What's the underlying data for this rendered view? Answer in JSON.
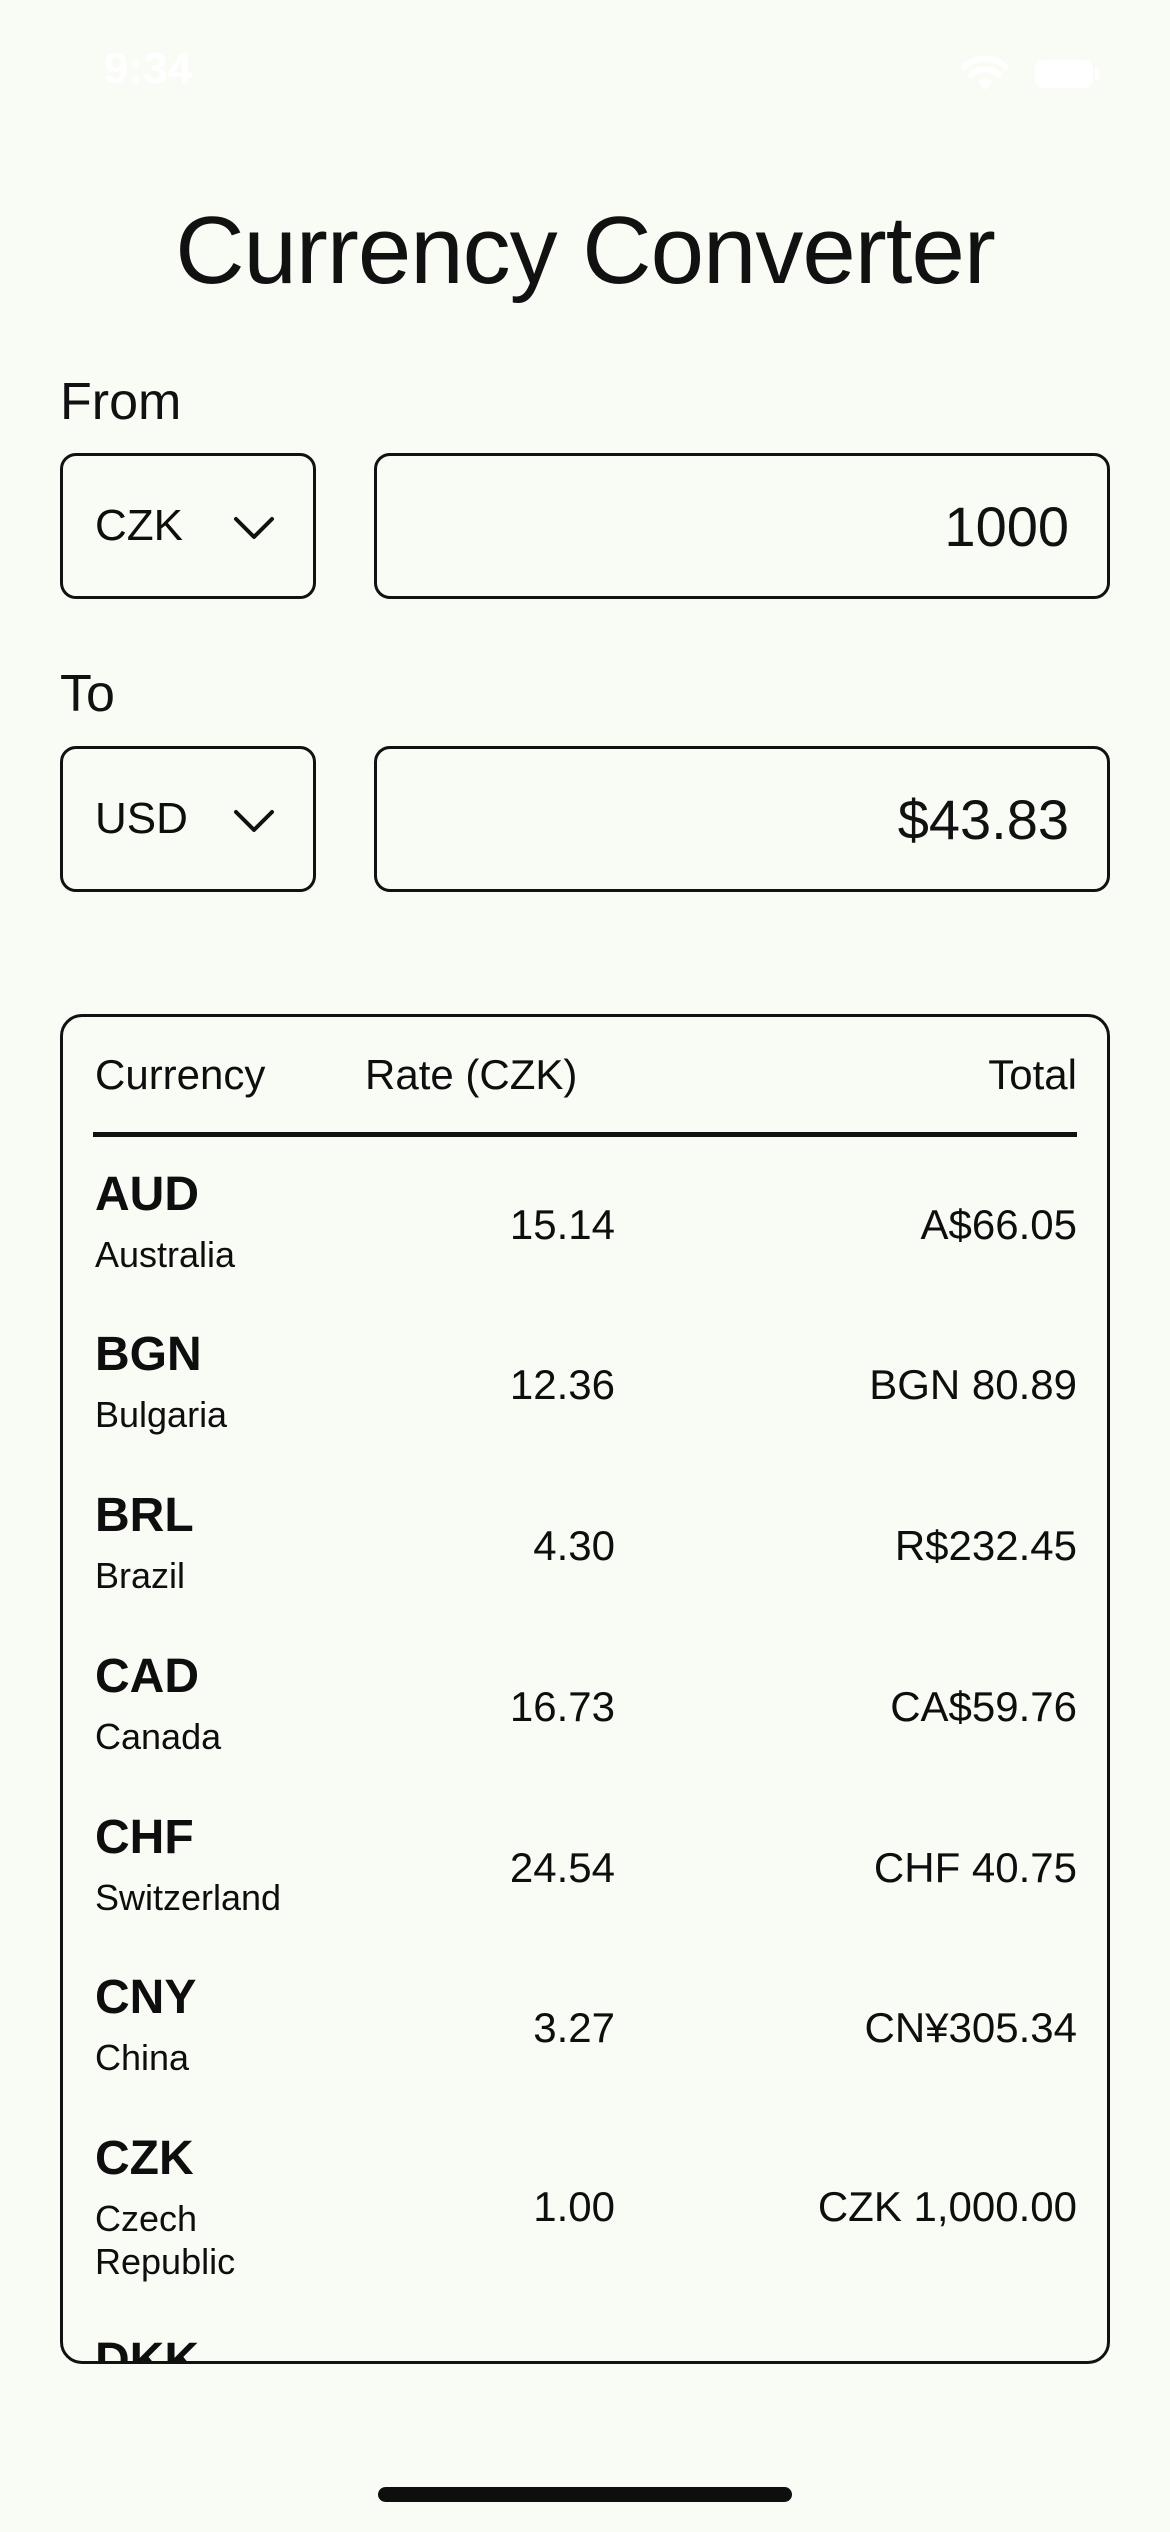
{
  "status_bar": {
    "time": "9:34",
    "icons": [
      "wifi-icon",
      "battery-icon"
    ]
  },
  "title": "Currency Converter",
  "from": {
    "label": "From",
    "currency": "CZK",
    "amount": "1000"
  },
  "to": {
    "label": "To",
    "currency": "USD",
    "amount": "$43.83"
  },
  "rates_table": {
    "headers": {
      "currency": "Currency",
      "rate": "Rate (CZK)",
      "total": "Total"
    },
    "rows": [
      {
        "code": "AUD",
        "country": "Australia",
        "rate": "15.14",
        "total": "A$66.05"
      },
      {
        "code": "BGN",
        "country": "Bulgaria",
        "rate": "12.36",
        "total": "BGN 80.89"
      },
      {
        "code": "BRL",
        "country": "Brazil",
        "rate": "4.30",
        "total": "R$232.45"
      },
      {
        "code": "CAD",
        "country": "Canada",
        "rate": "16.73",
        "total": "CA$59.76"
      },
      {
        "code": "CHF",
        "country": "Switzerland",
        "rate": "24.54",
        "total": "CHF 40.75"
      },
      {
        "code": "CNY",
        "country": "China",
        "rate": "3.27",
        "total": "CN¥305.34"
      },
      {
        "code": "CZK",
        "country": "Czech Republic",
        "rate": "1.00",
        "total": "CZK 1,000.00"
      },
      {
        "code": "DKK",
        "country": "",
        "rate": "",
        "total": ""
      }
    ]
  },
  "colors": {
    "background": "#f9fbf5",
    "text": "#0e0e0e",
    "border": "#111111"
  }
}
